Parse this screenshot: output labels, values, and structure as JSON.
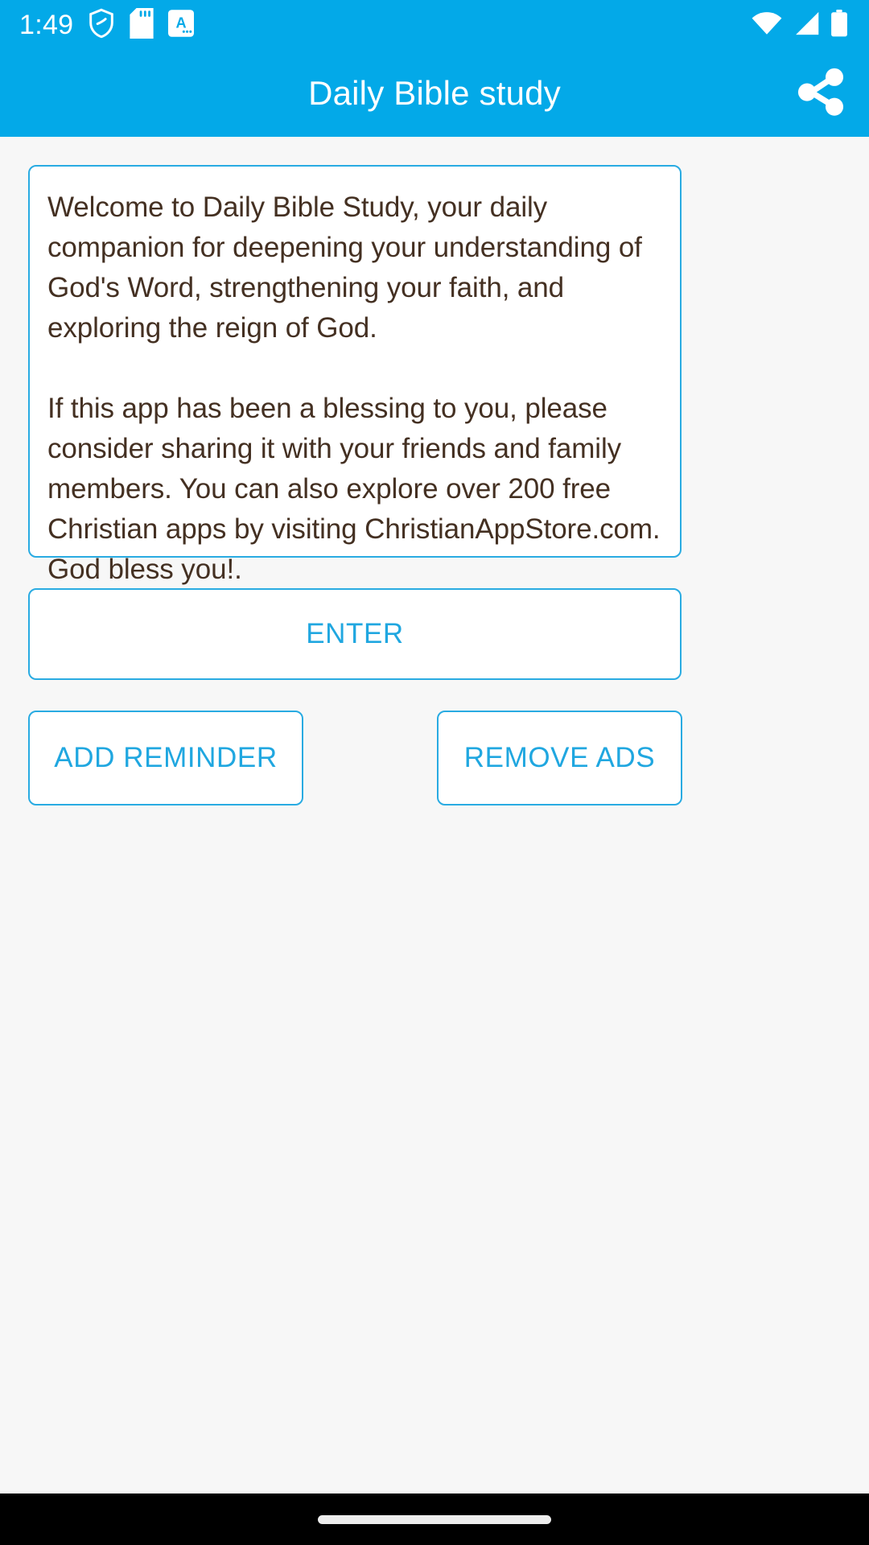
{
  "status_bar": {
    "time": "1:49",
    "left_icons": [
      "shield-icon",
      "sd-card-icon",
      "a-badge-icon"
    ],
    "right_icons": [
      "wifi-icon",
      "cellular-signal-icon",
      "battery-icon"
    ],
    "background_color": "#03A9E8"
  },
  "app_bar": {
    "title": "Daily Bible study",
    "share_icon": "share-icon",
    "background_color": "#03A9E8",
    "title_color": "#FFFFFF"
  },
  "main": {
    "welcome_text": "Welcome to Daily Bible Study, your daily companion for deepening your understanding of God's Word, strengthening your faith, and exploring the reign of God.\n\nIf this app has been a blessing to you, please consider sharing it with your friends and family members. You can also explore over 200 free Christian apps by visiting ChristianAppStore.com. God bless you!.",
    "text_color": "#443022",
    "card_border_color": "#29ABE2",
    "buttons": {
      "enter": "ENTER",
      "add_reminder": "ADD REMINDER",
      "remove_ads": "REMOVE ADS"
    },
    "accent_color": "#20A7E0",
    "background_color": "#F7F7F7"
  },
  "nav_bar": {
    "gesture_pill": "home-gesture-pill",
    "background_color": "#000000"
  }
}
